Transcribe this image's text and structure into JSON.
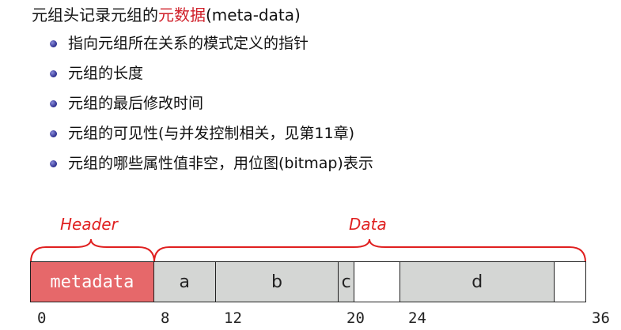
{
  "heading": {
    "prefix": "元组头记录元组的",
    "highlight": "元数据",
    "suffix": "(meta-data)"
  },
  "bullets": [
    "指向元组所在关系的模式定义的指针",
    "元组的长度",
    "元组的最后修改时间",
    "元组的可见性(与并发控制相关，见第11章)",
    "元组的哪些属性值非空，用位图(bitmap)表示"
  ],
  "diagram": {
    "header_label": "Header",
    "data_label": "Data",
    "fields": [
      {
        "label": "metadata",
        "start": 0,
        "end": 8,
        "fill": "#e6686a"
      },
      {
        "label": "a",
        "start": 8,
        "end": 12,
        "fill": "#d4d6d4"
      },
      {
        "label": "b",
        "start": 12,
        "end": 20,
        "fill": "#d4d6d4"
      },
      {
        "label": "c",
        "start": 20,
        "end": 21,
        "fill": "#d4d6d4"
      },
      {
        "label": "",
        "start": 21,
        "end": 24,
        "fill": "#ffffff"
      },
      {
        "label": "d",
        "start": 24,
        "end": 34,
        "fill": "#d4d6d4"
      },
      {
        "label": "",
        "start": 34,
        "end": 36,
        "fill": "#ffffff"
      }
    ],
    "ticks": [
      "0",
      "8",
      "12",
      "20",
      "24",
      "36"
    ],
    "colors": {
      "brace": "#e02020",
      "label": "#e02020",
      "metadata_fill": "#e6686a",
      "field_fill": "#d4d6d4"
    }
  }
}
